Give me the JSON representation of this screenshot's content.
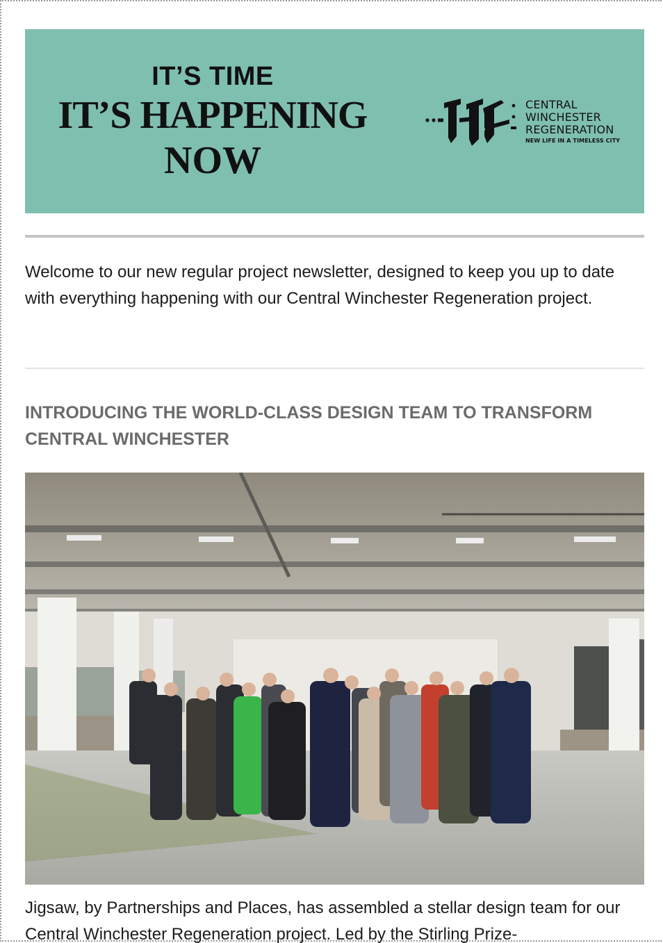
{
  "banner": {
    "line1": "IT’S TIME",
    "line2": "IT’S HAPPENING",
    "line3": "NOW",
    "background": "#7fbfaf"
  },
  "logo": {
    "line1": "CENTRAL",
    "line2": "WINCHESTER",
    "line3": "REGENERATION",
    "tagline": "NEW LIFE IN A TIMELESS CITY"
  },
  "intro": {
    "text": "Welcome to our new regular project newsletter, designed to keep you up to date with everything happening with our Central Winchester Regeneration project."
  },
  "article": {
    "heading": "INTRODUCING THE WORLD-CLASS DESIGN TEAM TO TRANSFORM CENTRAL WINCHESTER",
    "body": "Jigsaw, by Partnerships and Places, has assembled a stellar design team for our Central Winchester Regeneration project. Led by the Stirling Prize-"
  },
  "colors": {
    "heading": "#6b6b6b",
    "rule": "#c4c4c4"
  }
}
